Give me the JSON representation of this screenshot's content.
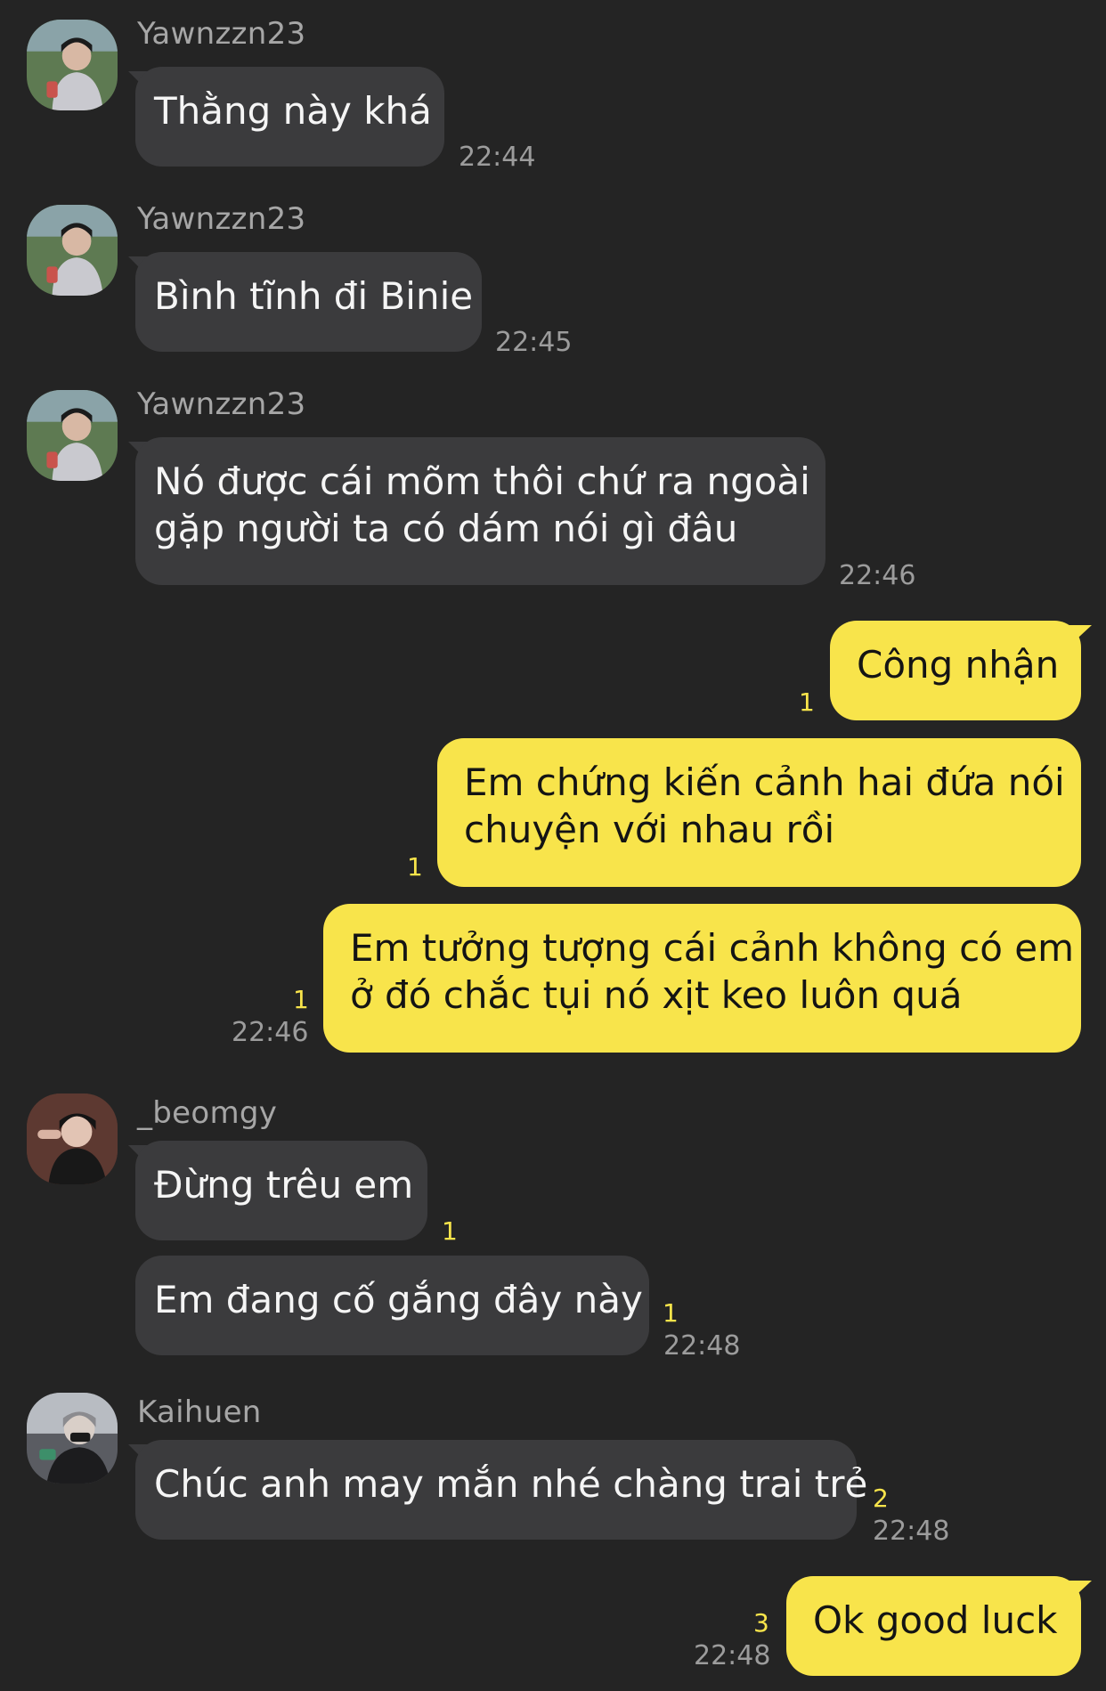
{
  "colors": {
    "background": "#242424",
    "incoming_bubble": "#3b3b3d",
    "outgoing_bubble": "#f8e44b",
    "unread_count": "#f8e44b",
    "timestamp": "#9c9c9c"
  },
  "groups": [
    {
      "sender": "Yawnzzn23",
      "messages": [
        {
          "text": "Thằng này khá",
          "time": "22:44"
        }
      ]
    },
    {
      "sender": "Yawnzzn23",
      "messages": [
        {
          "text": "Bình tĩnh đi Binie",
          "time": "22:45"
        }
      ]
    },
    {
      "sender": "Yawnzzn23",
      "messages": [
        {
          "lines": [
            "Nó được cái mõm thôi chứ ra ngoài",
            "gặp người ta có dám nói gì đâu"
          ],
          "time": "22:46"
        }
      ]
    },
    {
      "sender": "me",
      "messages": [
        {
          "text": "Công nhận",
          "unread": "1"
        },
        {
          "lines": [
            "Em chứng kiến cảnh hai đứa nói",
            "chuyện với nhau rồi"
          ],
          "unread": "1"
        },
        {
          "lines": [
            "Em tưởng tượng cái cảnh không có em",
            "ở đó chắc tụi nó xịt keo luôn quá"
          ],
          "unread": "1",
          "time": "22:46"
        }
      ]
    },
    {
      "sender": "_beomgy",
      "messages": [
        {
          "text": "Đừng trêu em",
          "unread": "1"
        },
        {
          "text": "Em đang cố gắng đây này",
          "unread": "1",
          "time": "22:48"
        }
      ]
    },
    {
      "sender": "Kaihuen",
      "messages": [
        {
          "text": "Chúc anh may mắn nhé chàng trai trẻ",
          "unread": "2",
          "time": "22:48"
        }
      ]
    },
    {
      "sender": "me",
      "messages": [
        {
          "text": "Ok good luck",
          "unread": "3",
          "time": "22:48"
        }
      ]
    }
  ]
}
